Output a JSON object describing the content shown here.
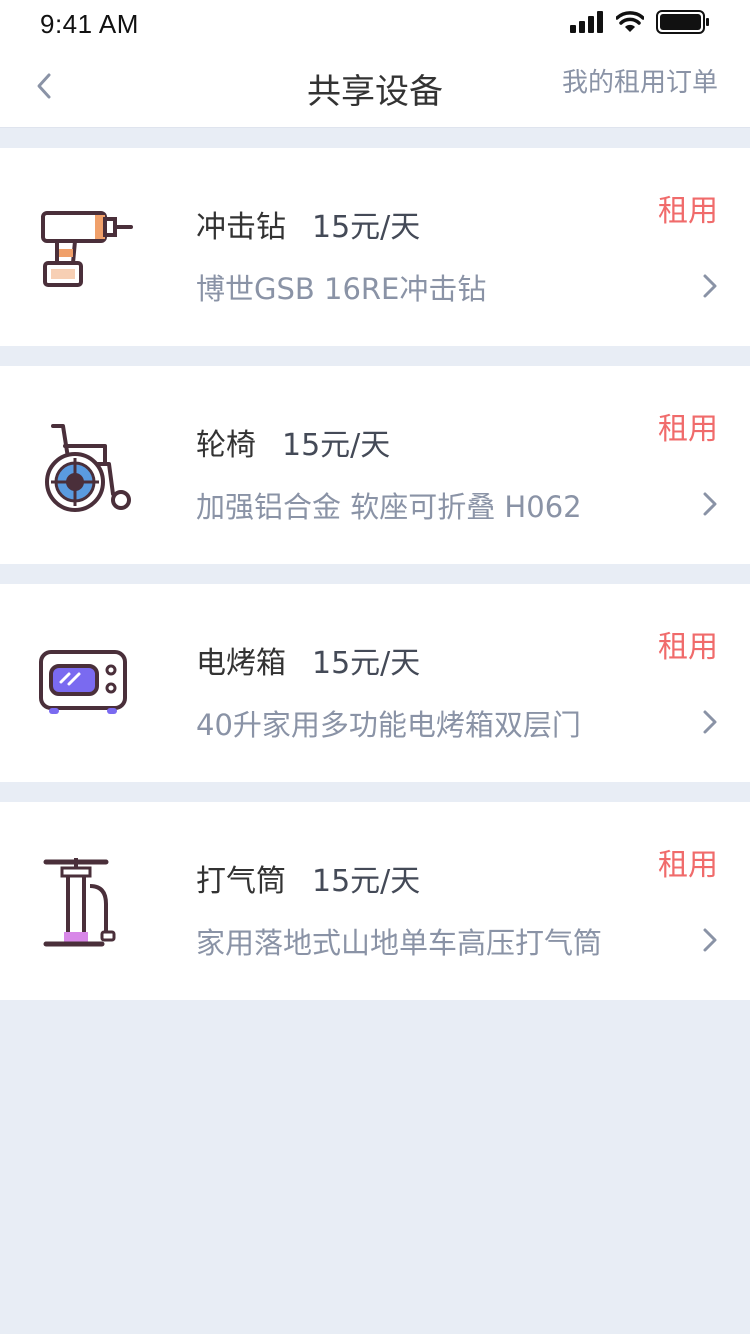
{
  "status_bar": {
    "time": "9:41 AM"
  },
  "nav": {
    "title": "共享设备",
    "right_link": "我的租用订单"
  },
  "items": [
    {
      "name": "冲击钻",
      "price": "15元/天",
      "description": "博世GSB 16RE冲击钻",
      "action": "租用",
      "icon": "drill-icon"
    },
    {
      "name": "轮椅",
      "price": "15元/天",
      "description": "加强铝合金 软座可折叠 H062",
      "action": "租用",
      "icon": "wheelchair-icon"
    },
    {
      "name": "电烤箱",
      "price": "15元/天",
      "description": "40升家用多功能电烤箱双层门",
      "action": "租用",
      "icon": "oven-icon"
    },
    {
      "name": "打气筒",
      "price": "15元/天",
      "description": "家用落地式山地单车高压打气筒",
      "action": "租用",
      "icon": "pump-icon"
    }
  ],
  "colors": {
    "accent": "#f06b6b",
    "muted": "#8a93a6",
    "background": "#e8edf5",
    "icon_dark": "#4a2f3a"
  }
}
